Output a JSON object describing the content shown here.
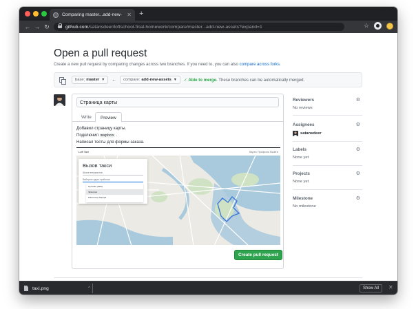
{
  "browser": {
    "tab_title": "Comparing master...add-new-",
    "url_host": "github.com",
    "url_path": "/satansdeer/loftschool-final-homework/compare/master...add-new-assets?expand=1"
  },
  "page": {
    "title": "Open a pull request",
    "subtitle": "Create a new pull request by comparing changes across two branches. If you need to, you can also ",
    "subtitle_link": "compare across forks."
  },
  "compare": {
    "base_label": "base:",
    "base_value": "master",
    "compare_label": "compare:",
    "compare_value": "add-new-assets",
    "status_ok": "✓ Able to merge.",
    "status_text": " These branches can be automatically merged."
  },
  "form": {
    "title_value": "Страница карты",
    "tab_write": "Write",
    "tab_preview": "Preview",
    "line1": "Добавил страницу карты.",
    "line2_pre": "Подключил ",
    "line2_code": "mapbox",
    "line2_post": " .",
    "line3": "Написал тесты для формы заказа.",
    "submit_label": "Create pull request"
  },
  "embedded": {
    "logo": "Loft Taxi",
    "nav": "Карта   Профиль   Выйти",
    "card_title": "Вызов такси",
    "field1": "Шоссе энтузиастов",
    "field2": "Выберите адрес прибытия",
    "options": [
      "Пулково (LED)",
      "Эрмитаж",
      "Кинотеатр Аврора"
    ]
  },
  "sidebar": {
    "reviewers": {
      "heading": "Reviewers",
      "value": "No reviews"
    },
    "assignees": {
      "heading": "Assignees",
      "value": "satansdeer"
    },
    "labels": {
      "heading": "Labels",
      "value": "None yet"
    },
    "projects": {
      "heading": "Projects",
      "value": "None yet"
    },
    "milestone": {
      "heading": "Milestone",
      "value": "No milestone"
    }
  },
  "downloads": {
    "file_name": "taxi.png",
    "show_all": "Show All"
  }
}
